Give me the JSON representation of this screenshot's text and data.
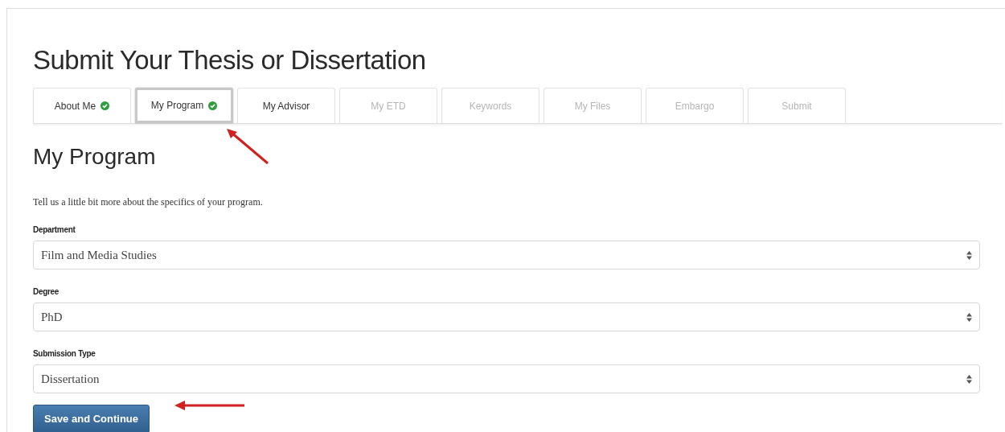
{
  "page_title": "Submit Your Thesis or Dissertation",
  "tabs": [
    {
      "label": "About Me",
      "complete": true,
      "selected": false,
      "disabled": false
    },
    {
      "label": "My Program",
      "complete": true,
      "selected": true,
      "disabled": false
    },
    {
      "label": "My Advisor",
      "complete": false,
      "selected": false,
      "disabled": false
    },
    {
      "label": "My ETD",
      "complete": false,
      "selected": false,
      "disabled": true
    },
    {
      "label": "Keywords",
      "complete": false,
      "selected": false,
      "disabled": true
    },
    {
      "label": "My Files",
      "complete": false,
      "selected": false,
      "disabled": true
    },
    {
      "label": "Embargo",
      "complete": false,
      "selected": false,
      "disabled": true
    },
    {
      "label": "Submit",
      "complete": false,
      "selected": false,
      "disabled": true
    }
  ],
  "section_title": "My Program",
  "intro": "Tell us a little bit more about the specifics of your program.",
  "fields": [
    {
      "label": "Department",
      "value": "Film and Media Studies"
    },
    {
      "label": "Degree",
      "value": "PhD"
    },
    {
      "label": "Submission Type",
      "value": "Dissertation"
    }
  ],
  "submit_button": "Save and Continue"
}
